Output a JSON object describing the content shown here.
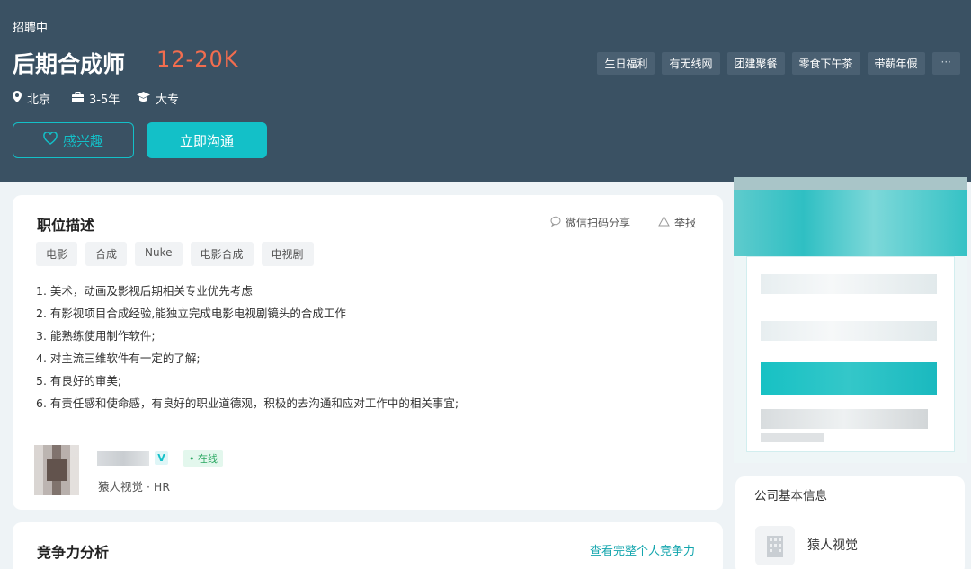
{
  "header": {
    "status": "招聘中",
    "title": "后期合成师",
    "salary": "12-20K",
    "location": "北京",
    "experience": "3-5年",
    "education": "大专",
    "benefits": [
      "生日福利",
      "有无线网",
      "团建聚餐",
      "零食下午茶",
      "带薪年假"
    ],
    "more_label": "···",
    "interest_label": "感兴趣",
    "chat_label": "立即沟通"
  },
  "job": {
    "heading": "职位描述",
    "share_label": "微信扫码分享",
    "report_label": "举报",
    "skills": [
      "电影",
      "合成",
      "Nuke",
      "电影合成",
      "电视剧"
    ],
    "description": [
      "1. 美术，动画及影视后期相关专业优先考虑",
      "2. 有影视项目合成经验,能独立完成电影电视剧镜头的合成工作",
      "3. 能熟练使用制作软件;",
      "4. 对主流三维软件有一定的了解;",
      "5. 有良好的审美;",
      "6. 有责任感和使命感，有良好的职业道德观，积极的去沟通和应对工作中的相关事宜;"
    ]
  },
  "recruiter": {
    "verified_badge": "V",
    "online_label": "• 在线",
    "company_role": "猿人视觉 · HR"
  },
  "competition": {
    "heading": "竞争力分析",
    "link_label": "查看完整个人竞争力"
  },
  "company_info": {
    "heading": "公司基本信息",
    "name": "猿人视觉"
  },
  "colors": {
    "header_bg": "#3a5163",
    "accent": "#13c0c8",
    "salary": "#f26d4f",
    "page_bg": "#eef3f6"
  }
}
